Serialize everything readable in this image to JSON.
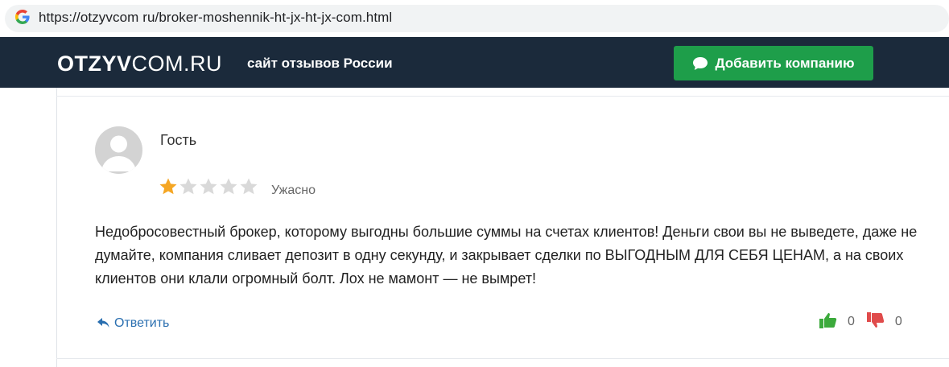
{
  "browser": {
    "url": "https://otzyvcom ru/broker-moshennik-ht-jx-ht-jx-com.html",
    "favicon": "google-g-icon"
  },
  "header": {
    "logo_bold": "OTZYV",
    "logo_light": "COM.RU",
    "tagline": "сайт отзывов России",
    "add_button_label": "Добавить компанию",
    "add_button_icon": "chat-bubble-icon",
    "background": "#1b2a3b",
    "button_color": "#1e9e4a"
  },
  "review": {
    "author": "Гость",
    "avatar": "user-placeholder-icon",
    "rating": 1,
    "rating_max": 5,
    "rating_label": "Ужасно",
    "star_color": "#f5a623",
    "text": "Недобросовестный брокер, которому выгодны большие суммы на счетах клиентов! Деньги свои вы не выведете, даже не думайте, компания сливает депозит в одну секунду, и закрывает сделки по ВЫГОДНЫМ ДЛЯ СЕБЯ ЦЕНАМ, а на своих клиентов они клали огромный болт. Лох не мамонт — не вымрет!",
    "reply_label": "Ответить",
    "likes": "0",
    "dislikes": "0"
  }
}
